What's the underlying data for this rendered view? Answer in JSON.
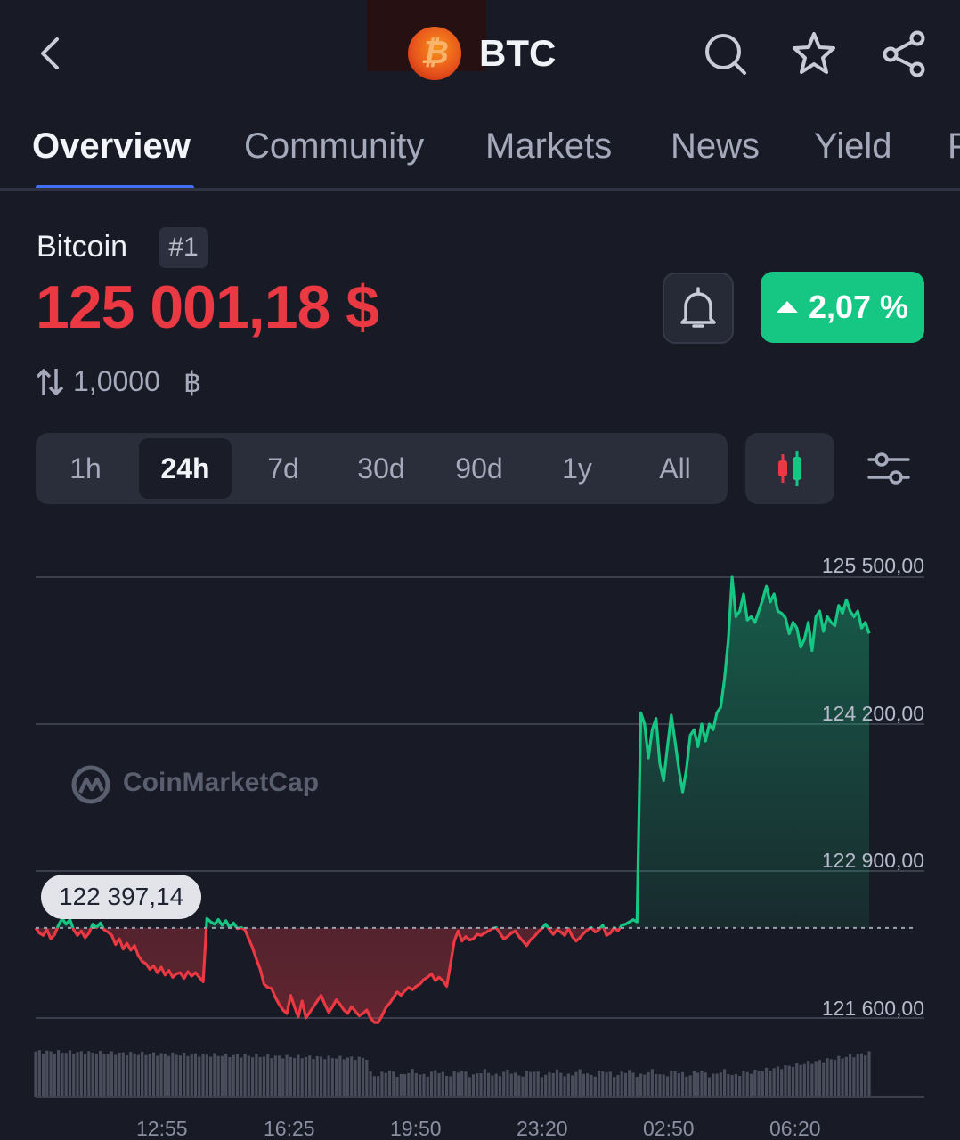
{
  "header": {
    "symbol": "BTC",
    "logo_glyph": "₿",
    "icons": [
      "back-icon",
      "search-icon",
      "star-icon",
      "share-icon"
    ]
  },
  "tabs": [
    {
      "label": "Overview",
      "active": true
    },
    {
      "label": "Community"
    },
    {
      "label": "Markets"
    },
    {
      "label": "News"
    },
    {
      "label": "Yield"
    },
    {
      "label": "P"
    }
  ],
  "coin": {
    "name": "Bitcoin",
    "rank": "#1",
    "price": "125 001,18 $",
    "change": "2,07 %",
    "conversion_value": "1,0000",
    "conversion_unit": "฿"
  },
  "ranges": [
    "1h",
    "24h",
    "7d",
    "30d",
    "90d",
    "1y",
    "All"
  ],
  "active_range": "24h",
  "chart": {
    "watermark": "CoinMarketCap",
    "reference_price_label": "122 397,14",
    "reference_price": 122397.14,
    "y_ticks": [
      "125 500,00",
      "124 200,00",
      "122 900,00",
      "121 600,00"
    ],
    "x_ticks": [
      "12:55",
      "16:25",
      "19:50",
      "23:20",
      "02:50",
      "06:20"
    ],
    "colors": {
      "up": "#16c784",
      "down": "#ea3943",
      "grid": "#3a3e4d",
      "volume": "#4a4e5c"
    }
  },
  "chart_data": {
    "type": "line",
    "x": [
      0,
      1,
      2,
      3,
      4,
      5,
      6,
      7,
      8,
      9,
      10,
      11,
      12,
      13,
      14,
      15,
      16,
      17,
      18,
      19,
      20,
      21,
      22,
      23,
      24,
      25,
      26,
      27,
      28,
      29,
      30,
      31,
      32,
      33,
      34,
      35,
      36,
      37,
      38,
      39,
      40,
      41,
      42,
      43,
      44,
      45,
      46,
      47,
      48,
      49,
      50,
      51,
      52,
      53,
      54,
      55,
      56,
      57,
      58,
      59,
      60,
      61,
      62,
      63,
      64,
      65,
      66,
      67,
      68,
      69,
      70,
      71,
      72,
      73,
      74,
      75,
      76,
      77,
      78,
      79,
      80,
      81,
      82,
      83,
      84,
      85,
      86,
      87,
      88,
      89,
      90,
      91,
      92,
      93,
      94,
      95,
      96,
      97,
      98,
      99,
      100,
      101,
      102,
      103,
      104,
      105,
      106,
      107,
      108,
      109,
      110,
      111,
      112,
      113,
      114,
      115,
      116,
      117,
      118,
      119,
      120,
      121,
      122,
      123,
      124,
      125,
      126,
      127,
      128,
      129,
      130,
      131,
      132,
      133,
      134,
      135,
      136,
      137,
      138,
      139,
      140,
      141,
      142,
      143,
      144,
      145,
      146,
      147,
      148,
      149,
      150,
      151,
      152,
      153,
      154,
      155,
      156,
      157,
      158,
      159,
      160,
      161,
      162,
      163,
      164,
      165,
      166,
      167,
      168,
      169,
      170,
      171,
      172,
      173,
      174,
      175,
      176,
      177,
      178,
      179,
      180,
      181,
      182,
      183,
      184,
      185,
      186,
      187,
      188,
      189,
      190,
      191,
      192,
      193,
      194,
      195,
      196,
      197,
      198,
      199,
      200,
      201,
      202,
      203,
      204,
      205,
      206,
      207,
      208,
      209,
      210,
      211,
      212,
      213,
      214,
      215,
      216,
      217,
      218,
      219,
      220,
      221,
      222,
      223,
      224,
      225,
      226,
      227,
      228,
      229,
      230,
      231,
      232,
      233,
      234
    ],
    "prices": [
      122397,
      122350,
      122330,
      122380,
      122300,
      122340,
      122420,
      122480,
      122430,
      122470,
      122380,
      122330,
      122370,
      122310,
      122350,
      122430,
      122400,
      122440,
      122380,
      122360,
      122330,
      122250,
      122300,
      122210,
      122260,
      122200,
      122240,
      122150,
      122100,
      122080,
      122030,
      122060,
      122000,
      122050,
      121980,
      122020,
      121960,
      121990,
      122000,
      121950,
      122010,
      121970,
      122000,
      121960,
      121920,
      122480,
      122450,
      122430,
      122470,
      122420,
      122460,
      122400,
      122440,
      122390,
      122400,
      122380,
      122300,
      122220,
      122120,
      122030,
      121900,
      121870,
      121860,
      121780,
      121720,
      121670,
      121640,
      121800,
      121700,
      121610,
      121750,
      121600,
      121650,
      121700,
      121750,
      121800,
      121720,
      121650,
      121700,
      121760,
      121720,
      121670,
      121640,
      121700,
      121660,
      121620,
      121640,
      121670,
      121600,
      121560,
      121560,
      121620,
      121690,
      121730,
      121780,
      121830,
      121800,
      121840,
      121870,
      121850,
      121880,
      121900,
      121940,
      121960,
      121990,
      121930,
      121960,
      121930,
      121880,
      122080,
      122280,
      122370,
      122280,
      122320,
      122290,
      122300,
      122340,
      122330,
      122350,
      122370,
      122390,
      122400,
      122350,
      122300,
      122320,
      122350,
      122370,
      122320,
      122280,
      122240,
      122290,
      122320,
      122360,
      122390,
      122430,
      122380,
      122340,
      122380,
      122360,
      122330,
      122390,
      122320,
      122280,
      122310,
      122350,
      122380,
      122400,
      122360,
      122380,
      122420,
      122330,
      122350,
      122400,
      122370,
      122420,
      122430,
      122450,
      122470,
      122450,
      124300,
      124200,
      123900,
      124150,
      124250,
      123850,
      123700,
      124000,
      124280,
      124050,
      123800,
      123600,
      123800,
      124100,
      124150,
      124000,
      124200,
      124050,
      124200,
      124150,
      124300,
      124350,
      124600,
      124950,
      125500,
      125150,
      125200,
      125350,
      125120,
      125150,
      125100,
      125200,
      125300,
      125420,
      125280,
      125350,
      125200,
      125180,
      125140,
      125000,
      125100,
      125050,
      124880,
      124950,
      125100,
      124850,
      125150,
      125200,
      125020,
      125150,
      125100,
      125070,
      125250,
      125180,
      125300,
      125200,
      125150,
      125200,
      125050,
      125100,
      125001
    ],
    "ylim": [
      121200,
      125900
    ],
    "ylabel": "",
    "xlabel": ""
  }
}
